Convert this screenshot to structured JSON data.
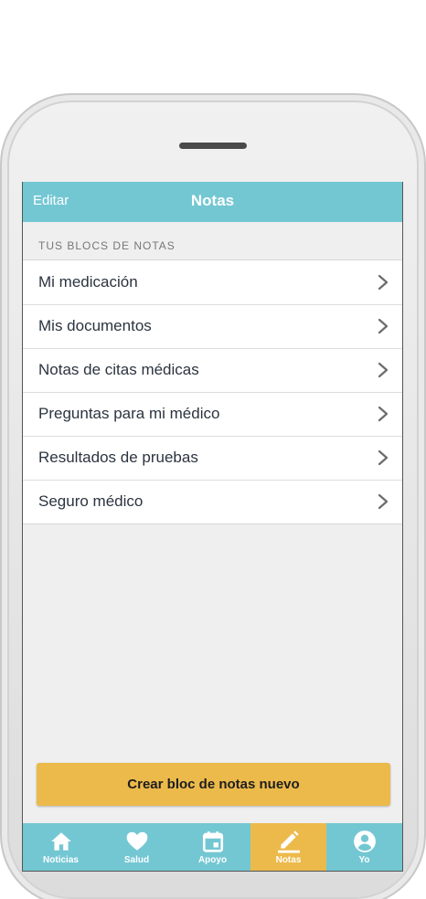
{
  "navbar": {
    "edit_label": "Editar",
    "title": "Notas"
  },
  "section": {
    "header": "TUS BLOCS DE NOTAS"
  },
  "notebooks": [
    {
      "label": "Mi medicación"
    },
    {
      "label": "Mis documentos"
    },
    {
      "label": "Notas de citas médicas"
    },
    {
      "label": "Preguntas para mi médico"
    },
    {
      "label": "Resultados de pruebas"
    },
    {
      "label": "Seguro médico"
    }
  ],
  "actions": {
    "create_label": "Crear bloc de notas nuevo"
  },
  "tabbar": {
    "tabs": [
      {
        "label": "Noticias",
        "icon": "home-icon"
      },
      {
        "label": "Salud",
        "icon": "heart-icon"
      },
      {
        "label": "Apoyo",
        "icon": "calendar-icon"
      },
      {
        "label": "Notas",
        "icon": "pencil-icon",
        "active": true
      },
      {
        "label": "Yo",
        "icon": "profile-icon"
      }
    ]
  },
  "colors": {
    "primary": "#73c7d3",
    "accent": "#ecba4b",
    "background": "#efefef",
    "text": "#2b3440"
  }
}
